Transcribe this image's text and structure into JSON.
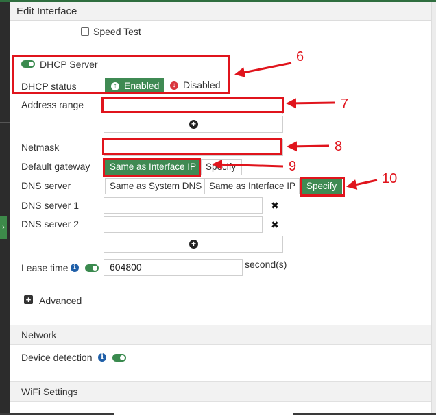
{
  "header": {
    "title": "Edit Interface"
  },
  "speed_test": {
    "label": "Speed Test"
  },
  "dhcp": {
    "server_label": "DHCP Server",
    "status_label": "DHCP status",
    "enabled_label": "Enabled",
    "disabled_label": "Disabled",
    "address_range_label": "Address range",
    "address_range_value": "",
    "netmask_label": "Netmask",
    "netmask_value": "",
    "default_gateway_label": "Default gateway",
    "gateway_same_label": "Same as Interface IP",
    "gateway_specify_label": "Specify",
    "dns_label": "DNS server",
    "dns_system_label": "Same as System DNS",
    "dns_interface_label": "Same as Interface IP",
    "dns_specify_label": "Specify",
    "dns1_label": "DNS server 1",
    "dns1_value": "",
    "dns2_label": "DNS server 2",
    "dns2_value": "",
    "lease_label": "Lease time",
    "lease_value": "604800",
    "lease_unit": "second(s)",
    "advanced_label": "Advanced"
  },
  "network": {
    "section_title": "Network",
    "device_detection_label": "Device detection"
  },
  "wifi": {
    "section_title": "WiFi Settings"
  },
  "annotations": {
    "n6": "6",
    "n7": "7",
    "n8": "8",
    "n9": "9",
    "n10": "10"
  },
  "colors": {
    "accent_green": "#3f8a53",
    "annotation_red": "#e0141c"
  }
}
